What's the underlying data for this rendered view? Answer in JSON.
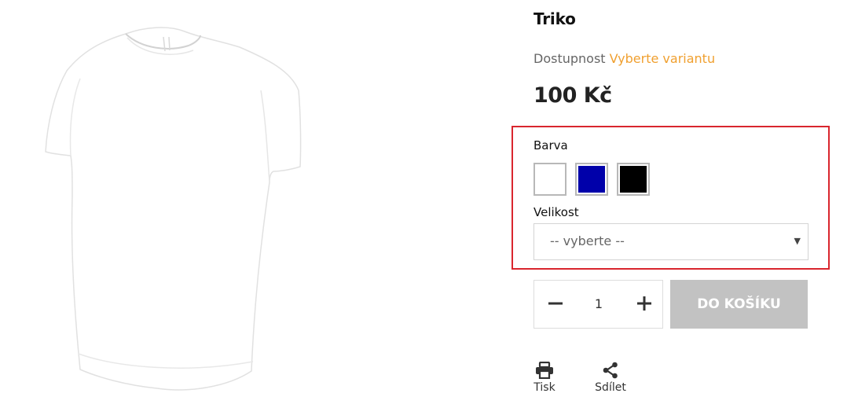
{
  "product": {
    "title": "Triko",
    "availability_label": "Dostupnost",
    "availability_value": "Vyberte variantu",
    "price": "100 Kč"
  },
  "variants": {
    "color_label": "Barva",
    "colors": [
      {
        "name": "white",
        "hex": "#ffffff"
      },
      {
        "name": "blue",
        "hex": "#0000aa"
      },
      {
        "name": "black",
        "hex": "#000000"
      }
    ],
    "size_label": "Velikost",
    "size_selected": "-- vyberte --"
  },
  "cart": {
    "quantity": "1",
    "add_label": "DO KOŠÍKU"
  },
  "actions": {
    "print_label": "Tisk",
    "share_label": "Sdílet"
  },
  "colors": {
    "accent": "#f0a030",
    "highlight_border": "#d9262e",
    "button_disabled": "#c2c2c2"
  },
  "icons": [
    "printer-icon",
    "share-icon",
    "minus-icon",
    "plus-icon",
    "chevron-down-icon"
  ]
}
